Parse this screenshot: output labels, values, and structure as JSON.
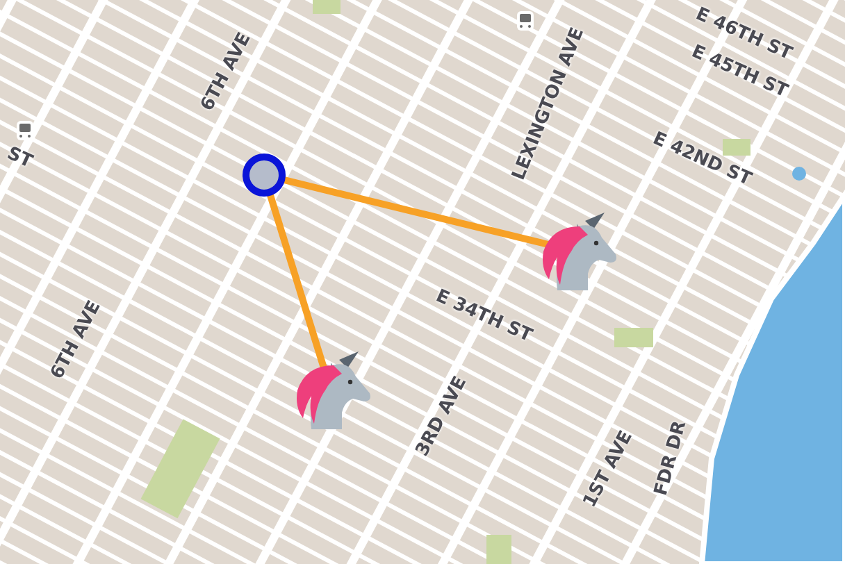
{
  "map": {
    "street_labels": [
      {
        "text": "6TH AVE"
      },
      {
        "text": "LEXINGTON AVE"
      },
      {
        "text": "E 46TH ST"
      },
      {
        "text": "E 45TH ST"
      },
      {
        "text": "E 42ND ST"
      },
      {
        "text": "ST"
      },
      {
        "text": "E 34TH ST"
      },
      {
        "text": "6TH AVE"
      },
      {
        "text": "3RD AVE"
      },
      {
        "text": "1ST AVE"
      },
      {
        "text": "FDR DR"
      }
    ]
  },
  "markers": [
    {
      "kind": "origin"
    },
    {
      "kind": "unicorn"
    },
    {
      "kind": "unicorn"
    }
  ]
}
